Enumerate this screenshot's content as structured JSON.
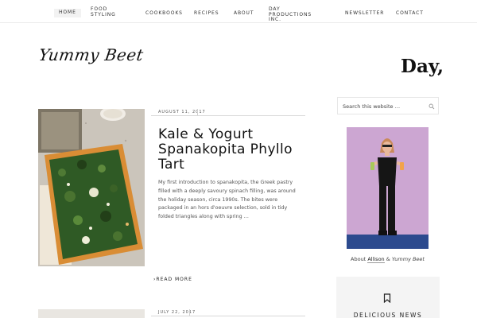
{
  "nav": {
    "home": "HOME",
    "food_styling": "FOOD STYLING",
    "cookbooks": "COOKBOOKS",
    "recipes": "RECIPES",
    "about": "ABOUT",
    "day_productions": "DAY PRODUCTIONS INC.",
    "newsletter": "NEWSLETTER",
    "contact": "CONTACT"
  },
  "header": {
    "logo": "Yummy Beet",
    "day_word": "Day,"
  },
  "posts": [
    {
      "date": "AUGUST 11, 2017",
      "title": "Kale & Yogurt Spanakopita Phyllo Tart",
      "excerpt": "My first introduction to spanakopita, the Greek pastry filled with a deeply savoury spinach filling, was around the holiday season, circa 1990s. The bites were packaged in an hors d'oeuvre selection, sold in tidy folded triangles along with spring …",
      "read_more": "READ MORE"
    },
    {
      "date": "JULY 22, 2017"
    }
  ],
  "sidebar": {
    "search_placeholder": "Search this website …",
    "about_prefix": "About",
    "about_name": "Allison",
    "about_amp": "&",
    "about_site": "Yummy Beet",
    "newsletter_title": "DELICIOUS NEWS"
  },
  "colors": {
    "accent_bg": "#f4f4f4",
    "nav_active_bg": "#f2f2f2",
    "profile_bg": "#c9a8d0"
  }
}
